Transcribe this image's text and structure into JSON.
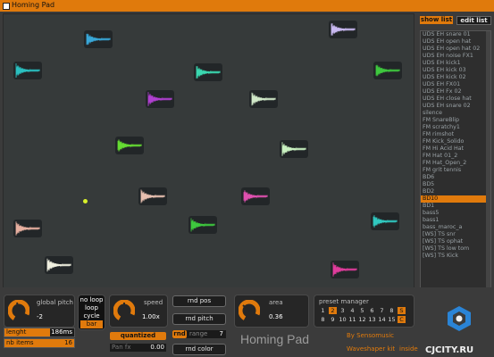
{
  "window": {
    "title": "Homing Pad"
  },
  "sidebar": {
    "tabs": [
      {
        "label": "show list"
      },
      {
        "label": "edit list"
      }
    ],
    "items": [
      "UDS EH snare 01",
      "UDS EH open hat",
      "UDS EH open hat 02",
      "UDS EH noise FX1",
      "UDS EH kick1",
      "UDS EH kick 03",
      "UDS EH kick 02",
      "UDS EH FX01",
      "UDS EH Fx 02",
      "UDS EH close hat",
      "UDS EH snare 02",
      "silence",
      "FM SnareBlip",
      "FM scratchy1",
      "FM rimshot",
      "FM Kick_Solido",
      "FM Hi Acid Hat",
      "FM Hat 01_2",
      "FM Hat_Open_2",
      "FM grit tennis",
      "BD6",
      "BD5",
      "BD2",
      "BD10",
      "BD1",
      "bass5",
      "bass1",
      "bass_maroc_a",
      "[WS] TS snr",
      "[WS] TS ophat",
      "[WS] TS low tom",
      "[WS] TS Kick"
    ],
    "selected_index": 23
  },
  "pad": {
    "tiles": [
      {
        "color": "#c8b8f0"
      },
      {
        "color": "#39a7d8"
      },
      {
        "color": "#2ac0c0"
      },
      {
        "color": "#3ad8b0"
      },
      {
        "color": "#3ec83e"
      },
      {
        "color": "#b040d0"
      },
      {
        "color": "#d0e8c8"
      },
      {
        "color": "#66dd33"
      },
      {
        "color": "#c8f0c0"
      },
      {
        "color": "#e8c0b0"
      },
      {
        "color": "#e050b0"
      },
      {
        "color": "#3ec83e"
      },
      {
        "color": "#e8b0a0"
      },
      {
        "color": "#30c8c0"
      },
      {
        "color": "#f0f0e0"
      },
      {
        "color": "#e03c9c"
      }
    ]
  },
  "controls": {
    "global_pitch": {
      "label": "global pitch",
      "value": "-2"
    },
    "loop_mode": {
      "options": [
        "no loop",
        "loop",
        "cycle",
        "bar"
      ],
      "selected": "bar"
    },
    "speed": {
      "label": "speed",
      "value": "1.00x"
    },
    "quantized_label": "quantized",
    "pan_fx": {
      "label": "Pan fx",
      "value": "0.00"
    },
    "lenght": {
      "label": "lenght",
      "value": "186ms",
      "level": 0.65
    },
    "nb_items": {
      "label": "nb items",
      "value": "16",
      "level": 1.0
    },
    "rnd_pos_label": "rnd pos",
    "rnd_pitch_label": "rnd pitch",
    "rnd_label": "rnd",
    "range": {
      "label": "range",
      "value": "7"
    },
    "rnd_color_label": "rnd color",
    "area": {
      "label": "area",
      "value": "0.36"
    },
    "preset_manager": {
      "label": "preset manager",
      "row1": [
        "1",
        "2",
        "3",
        "4",
        "5",
        "6",
        "7",
        "8",
        "S"
      ],
      "row2": [
        "8",
        "9",
        "10",
        "11",
        "12",
        "13",
        "14",
        "15",
        "C"
      ]
    }
  },
  "footer": {
    "app_name": "Homing Pad",
    "by": "By Sensomusic",
    "kit": "Waveshaper kit",
    "inside": "inside",
    "watermark": "CJCITY.RU"
  },
  "colors": {
    "accent": "#e07a0c",
    "background": "#3b3b3b",
    "pad": "#363a3a"
  }
}
